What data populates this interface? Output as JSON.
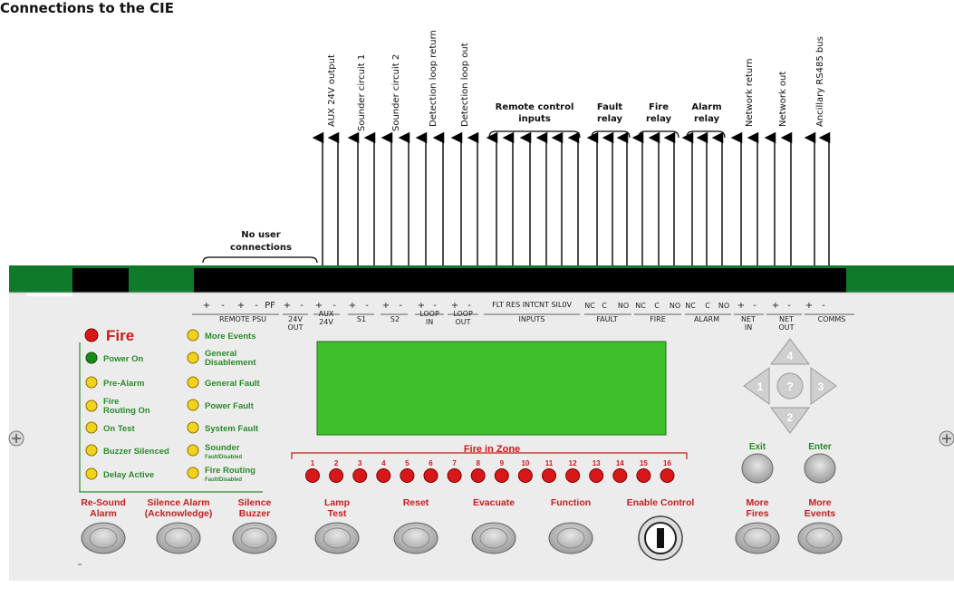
{
  "title": "Connections to the CIE",
  "top_labels": {
    "vertical": [
      "AUX 24V output",
      "Sounder circuit 1",
      "Sounder circuit 2",
      "Detection loop return",
      "Detection loop out",
      "Network return",
      "Network out",
      "Ancillary RS485 bus"
    ],
    "remote_control": [
      "Remote control",
      "inputs"
    ],
    "fault_relay": [
      "Fault",
      "relay"
    ],
    "fire_relay": [
      "Fire",
      "relay"
    ],
    "alarm_relay": [
      "Alarm",
      "relay"
    ],
    "no_user": [
      "No user",
      "connections"
    ]
  },
  "terminals": {
    "remote_psu": "REMOTE PSU",
    "out24": [
      "24V",
      "OUT"
    ],
    "aux24": [
      "AUX",
      "24V"
    ],
    "s1": "S1",
    "s2": "S2",
    "loop_in": [
      "LOOP",
      "IN"
    ],
    "loop_out": [
      "LOOP",
      "OUT"
    ],
    "inputs_top": "FLT RES INTCNT SIL0V",
    "inputs": "INPUTS",
    "fault": "FAULT",
    "fire": "FIRE",
    "alarm": "ALARM",
    "net_in": [
      "NET",
      "IN"
    ],
    "net_out": [
      "NET",
      "OUT"
    ],
    "comms": "COMMS",
    "polarity": [
      "+",
      "-",
      "+",
      "-",
      "PF",
      "+",
      "-",
      "+",
      "-",
      "+",
      "-",
      "+",
      "-",
      "+",
      "-",
      "+",
      "-",
      "+",
      "-",
      "+",
      "-",
      "+",
      "-"
    ],
    "relay_marks": [
      "NC",
      "C",
      "NO",
      "NC",
      "C",
      "NO",
      "NC",
      "C",
      "NO"
    ]
  },
  "fire_indicator": "Fire",
  "leds_left": [
    "Power On",
    "Pre-Alarm",
    "Fire",
    "On Test",
    "Buzzer Silenced",
    "Delay Active"
  ],
  "fire_routing_on": [
    "Fire",
    "Routing On"
  ],
  "leds_right": [
    "More Events",
    "General",
    "General Fault",
    "Power Fault",
    "System Fault",
    "Sounder",
    "Fire Routing"
  ],
  "leds_right_sub": {
    "general": "Disablement",
    "sounder": "Fault/Disabled",
    "fire_routing": "Fault/Disabled"
  },
  "fire_in_zone": "Fire in Zone",
  "zones": [
    "1",
    "2",
    "3",
    "4",
    "5",
    "6",
    "7",
    "8",
    "9",
    "10",
    "11",
    "12",
    "13",
    "14",
    "15",
    "16"
  ],
  "nav": {
    "up": "4",
    "left": "1",
    "center": "?",
    "right": "3",
    "down": "2"
  },
  "exit": "Exit",
  "enter": "Enter",
  "buttons": [
    [
      "Re-Sound",
      "Alarm"
    ],
    [
      "Silence Alarm",
      "(Acknowledge)"
    ],
    [
      "Silence",
      "Buzzer"
    ],
    [
      "Lamp",
      "Test"
    ],
    [
      "Reset"
    ],
    [
      "Evacuate"
    ],
    [
      "Function"
    ],
    [
      "Enable Control"
    ],
    [
      "More",
      "Fires"
    ],
    [
      "More",
      "Events"
    ]
  ],
  "colors": {
    "pcb_green": "#0f7a2a",
    "panel": "#ececec",
    "led_red": "#d81818",
    "led_green": "#1a8a1a",
    "led_yellow": "#f2d21a",
    "lcd": "#3fbf2c"
  }
}
